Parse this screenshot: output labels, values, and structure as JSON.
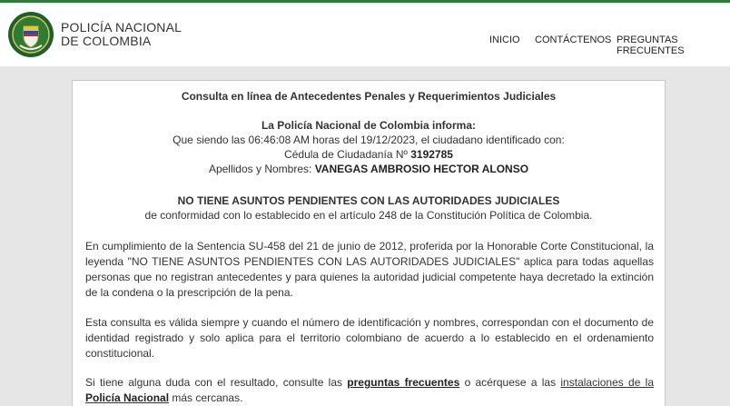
{
  "header": {
    "brand_line1": "POLICÍA NACIONAL",
    "brand_line2": "DE COLOMBIA",
    "logo_icon": "police-shield-emblem",
    "nav": [
      "INICIO",
      "CONTÁCTENOS",
      "PREGUNTAS FRECUENTES"
    ]
  },
  "result": {
    "title": "Consulta en línea de Antecedentes Penales y Requerimientos Judiciales",
    "informs": "La Policía Nacional de Colombia informa:",
    "line_time": "Que siendo las 06:46:08 AM horas del 19/12/2023, el ciudadano identificado con:",
    "id_label": "Cédula de Ciudadanía Nº",
    "id_value": "3192785",
    "name_label": "Apellidos y Nombres:",
    "name_value": "VANEGAS AMBROSIO HECTOR ALONSO",
    "status": "NO TIENE ASUNTOS PENDIENTES CON LAS AUTORIDADES JUDICIALES",
    "status_basis": "de conformidad con lo establecido en el artículo 248 de la Constitución Política de Colombia.",
    "paragraph1": "En cumplimiento de la Sentencia SU-458 del 21 de junio de 2012, proferida por la Honorable Corte Constitucional, la leyenda \"NO TIENE ASUNTOS PENDIENTES CON LAS AUTORIDADES JUDICIALES\" aplica para todas aquellas personas que no registran antecedentes y para quienes la autoridad judicial competente haya decretado la extinción de la condena o la prescripción de la pena.",
    "paragraph2": "Esta consulta es válida siempre y cuando el número de identificación y nombres, correspondan con el documento de identidad registrado y solo aplica para el territorio colombiano de acuerdo a lo establecido en el ordenamiento constitucional.",
    "p3_prefix": "Si tiene alguna duda con el resultado, consulte las",
    "p3_link1": "preguntas frecuentes",
    "p3_middle": "o acérquese a las",
    "p3_link2_plain": "instalaciones de la",
    "p3_link2_bold": "Policía Nacional",
    "p3_suffix": "más cercanas."
  },
  "colors": {
    "accent_green": "#2e7d32",
    "background": "#e6e6e6"
  }
}
